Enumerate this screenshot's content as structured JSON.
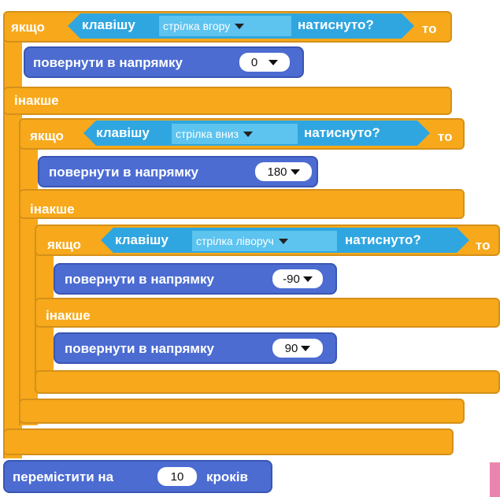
{
  "if1": {
    "if_label": "якщо",
    "then_label": "то",
    "else_label": "інакше"
  },
  "key1": {
    "prefix": "клавішу",
    "option": "стрілка вгору",
    "suffix": "натиснуто?"
  },
  "turn1": {
    "label": "повернути в напрямку",
    "value": "0"
  },
  "if2": {
    "if_label": "якщо",
    "then_label": "то",
    "else_label": "інакше"
  },
  "key2": {
    "prefix": "клавішу",
    "option": "стрілка вниз",
    "suffix": "натиснуто?"
  },
  "turn2": {
    "label": "повернути в напрямку",
    "value": "180"
  },
  "if3": {
    "if_label": "якщо",
    "then_label": "то",
    "else_label": "інакше"
  },
  "key3": {
    "prefix": "клавішу",
    "option": "стрілка ліворуч",
    "suffix": "натиснуто?"
  },
  "turn3": {
    "label": "повернути в напрямку",
    "value": "-90"
  },
  "turn4": {
    "label": "повернути в напрямку",
    "value": "90"
  },
  "move": {
    "prefix": "перемістити на",
    "value": "10",
    "suffix": "кроків"
  },
  "colors": {
    "control": "#f7a91b",
    "motion": "#4c6cd2",
    "sensing": "#2fa6e0",
    "sensing_menu": "#5dc3ef",
    "page_marker": "#ea85b0"
  }
}
